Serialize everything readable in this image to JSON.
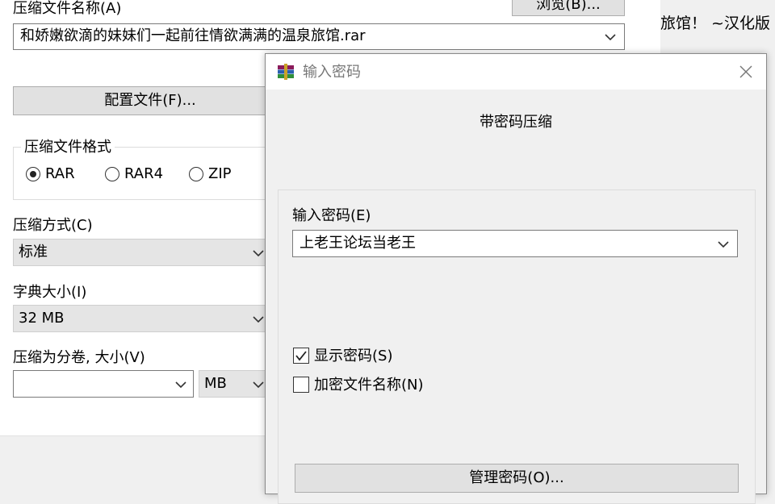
{
  "main": {
    "archive_name_label": "压缩文件名称(A)",
    "archive_name_value": "和娇嫩欲滴的妹妹们一起前往情欲满满的温泉旅馆.rar",
    "browse_button": "浏览(B)...",
    "profiles_button": "配置文件(F)...",
    "format_group_label": "压缩文件格式",
    "formats": [
      {
        "label": "RAR",
        "selected": true
      },
      {
        "label": "RAR4",
        "selected": false
      },
      {
        "label": "ZIP",
        "selected": false
      }
    ],
    "method_label": "压缩方式(C)",
    "method_value": "标准",
    "dict_label": "字典大小(I)",
    "dict_value": "32 MB",
    "split_label": "压缩为分卷, 大小(V)",
    "split_value": "",
    "split_unit": "MB"
  },
  "background": {
    "partial_title_text": "旅馆！ ~汉化版"
  },
  "password_dialog": {
    "title": "输入密码",
    "heading": "带密码压缩",
    "password_label": "输入密码(E)",
    "password_value": "上老王论坛当老王",
    "show_password_label": "显示密码(S)",
    "show_password_checked": true,
    "encrypt_names_label": "加密文件名称(N)",
    "encrypt_names_checked": false,
    "organize_button": "管理密码(O)..."
  },
  "colors": {
    "dialog_bg": "#f0f0f0",
    "button_bg": "#e1e1e1",
    "field_border": "#7a7a7a"
  }
}
